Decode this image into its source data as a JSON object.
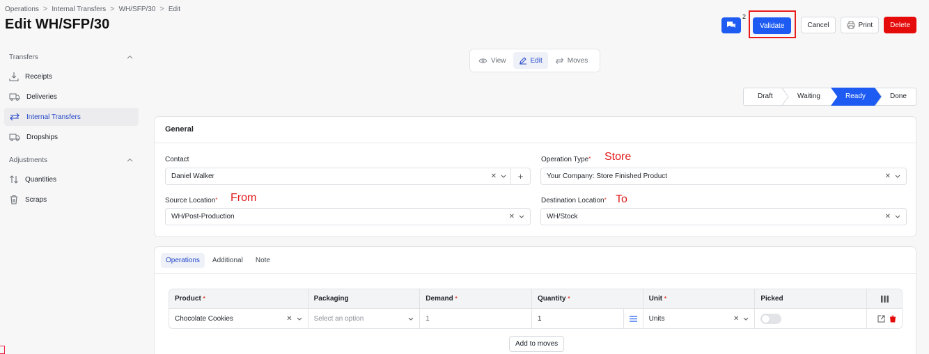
{
  "breadcrumb": {
    "items": [
      "Operations",
      "Internal Transfers",
      "WH/SFP/30",
      "Edit"
    ],
    "separator": ">"
  },
  "page_title": "Edit WH/SFP/30",
  "toolbar": {
    "chat_count": "2",
    "validate_label": "Validate",
    "cancel_label": "Cancel",
    "print_label": "Print",
    "delete_label": "Delete",
    "colors": {
      "primary": "#1d5bf2",
      "danger": "#e60b0b",
      "highlight": "#e81b1b"
    }
  },
  "sidebar": {
    "transfers_heading": "Transfers",
    "transfers": [
      {
        "label": "Receipts",
        "icon": "download-icon"
      },
      {
        "label": "Deliveries",
        "icon": "truck-icon"
      },
      {
        "label": "Internal Transfers",
        "icon": "transfer-arrows-icon",
        "active": true
      },
      {
        "label": "Dropships",
        "icon": "truck-icon"
      }
    ],
    "adjustments_heading": "Adjustments",
    "adjustments": [
      {
        "label": "Quantities",
        "icon": "sort-arrows-icon"
      },
      {
        "label": "Scraps",
        "icon": "trash-icon"
      }
    ]
  },
  "view_tabs": {
    "view": "View",
    "edit": "Edit",
    "moves": "Moves",
    "active": "Edit"
  },
  "status": {
    "steps": [
      "Draft",
      "Waiting",
      "Ready",
      "Done"
    ],
    "current": "Ready"
  },
  "general": {
    "title": "General",
    "contact_label": "Contact",
    "contact_value": "Daniel Walker",
    "operation_type_label": "Operation Type",
    "operation_type_value": "Your Company: Store Finished Product",
    "source_location_label": "Source Location",
    "source_location_value": "WH/Post-Production",
    "destination_location_label": "Destination Location",
    "destination_location_value": "WH/Stock",
    "required_mark": "*"
  },
  "annotations": {
    "store": "Store",
    "from": "From",
    "to": "To"
  },
  "operations": {
    "tabs": [
      "Operations",
      "Additional",
      "Note"
    ],
    "active_tab": "Operations",
    "columns": [
      "Product",
      "Packaging",
      "Demand",
      "Quantity",
      "Unit",
      "Picked"
    ],
    "rows": [
      {
        "product": "Chocolate Cookies",
        "packaging_placeholder": "Select an option",
        "demand": "1",
        "quantity": "1",
        "unit": "Units",
        "picked": false
      }
    ],
    "add_moves_label": "Add to moves"
  }
}
